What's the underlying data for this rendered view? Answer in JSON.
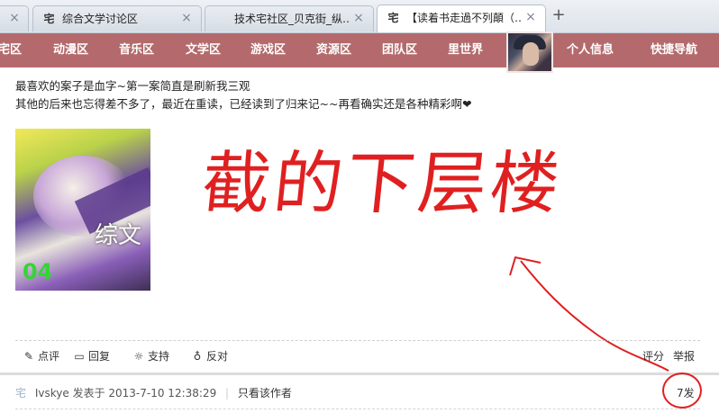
{
  "browser": {
    "tabs": [
      {
        "favicon": "宅",
        "label": "综合文学讨论区",
        "close": "×"
      },
      {
        "favicon": "",
        "label": "技术宅社区_贝克街_纵…",
        "close": "×"
      },
      {
        "favicon": "宅",
        "label": "【读着书走過不列顛（…",
        "close": "×",
        "active": true
      }
    ],
    "new_tab": "+"
  },
  "nav": {
    "items": [
      "宅区",
      "动漫区",
      "音乐区",
      "文学区",
      "游戏区",
      "资源区",
      "团队区",
      "里世界"
    ],
    "right_items": [
      "个人信息",
      "快捷导航"
    ]
  },
  "post": {
    "line1": "最喜欢的案子是血字~第一案简直是刷新我三观",
    "line2": "其他的后来也忘得差不多了，最近在重读，已经读到了归来记~~再看确实还是各种精彩啊❤",
    "image_caption": "综文",
    "image_number": "04",
    "annotation": "截的下层楼"
  },
  "actions": {
    "left": [
      {
        "icon": "comment-icon",
        "glyph": "✎",
        "label": "点评"
      },
      {
        "icon": "reply-icon",
        "glyph": "▭",
        "label": "回复"
      },
      {
        "icon": "lightbulb-icon",
        "glyph": "☼",
        "label": "支持"
      },
      {
        "icon": "oppose-icon",
        "glyph": "♁",
        "label": "反对"
      }
    ],
    "right": [
      "评分",
      "举报"
    ]
  },
  "meta": {
    "zhai": "宅",
    "author": "Ivskye",
    "posted": "发表于 2013-7-10 12:38:29",
    "only_author": "只看该作者",
    "floor": "7发"
  },
  "colors": {
    "nav_bg": "#b46a6c",
    "annotation": "#e02020"
  }
}
